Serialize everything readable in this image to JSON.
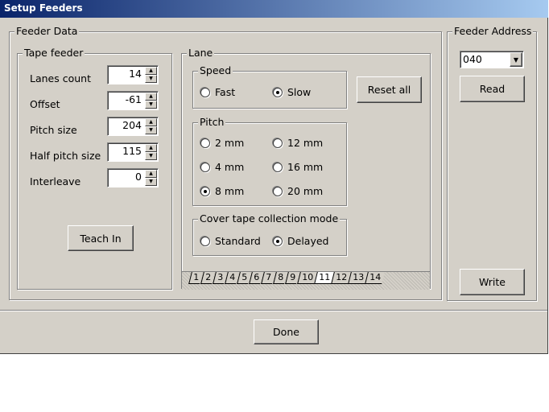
{
  "window": {
    "title": "Setup Feeders"
  },
  "feeder_data": {
    "title": "Feeder Data",
    "tape_feeder": {
      "title": "Tape feeder",
      "fields": [
        {
          "label": "Lanes count",
          "value": "14"
        },
        {
          "label": "Offset",
          "value": "-61"
        },
        {
          "label": "Pitch size",
          "value": "204"
        },
        {
          "label": "Half pitch size",
          "value": "115"
        },
        {
          "label": "Interleave",
          "value": "0"
        }
      ],
      "teach_in": "Teach In"
    },
    "lane": {
      "title": "Lane",
      "reset_all": "Reset all",
      "speed": {
        "title": "Speed",
        "options": [
          "Fast",
          "Slow"
        ],
        "selected": "Slow"
      },
      "pitch": {
        "title": "Pitch",
        "options": [
          "2 mm",
          "12 mm",
          "4 mm",
          "16 mm",
          "8 mm",
          "20 mm"
        ],
        "selected": "8 mm"
      },
      "cover": {
        "title": "Cover tape collection mode",
        "options": [
          "Standard",
          "Delayed"
        ],
        "selected": "Delayed"
      },
      "tabs": [
        "1",
        "2",
        "3",
        "4",
        "5",
        "6",
        "7",
        "8",
        "9",
        "10",
        "11",
        "12",
        "13",
        "14"
      ],
      "selected_tab": "11"
    }
  },
  "feeder_address": {
    "title": "Feeder Address",
    "value": "040",
    "read": "Read",
    "write": "Write"
  },
  "done": "Done"
}
